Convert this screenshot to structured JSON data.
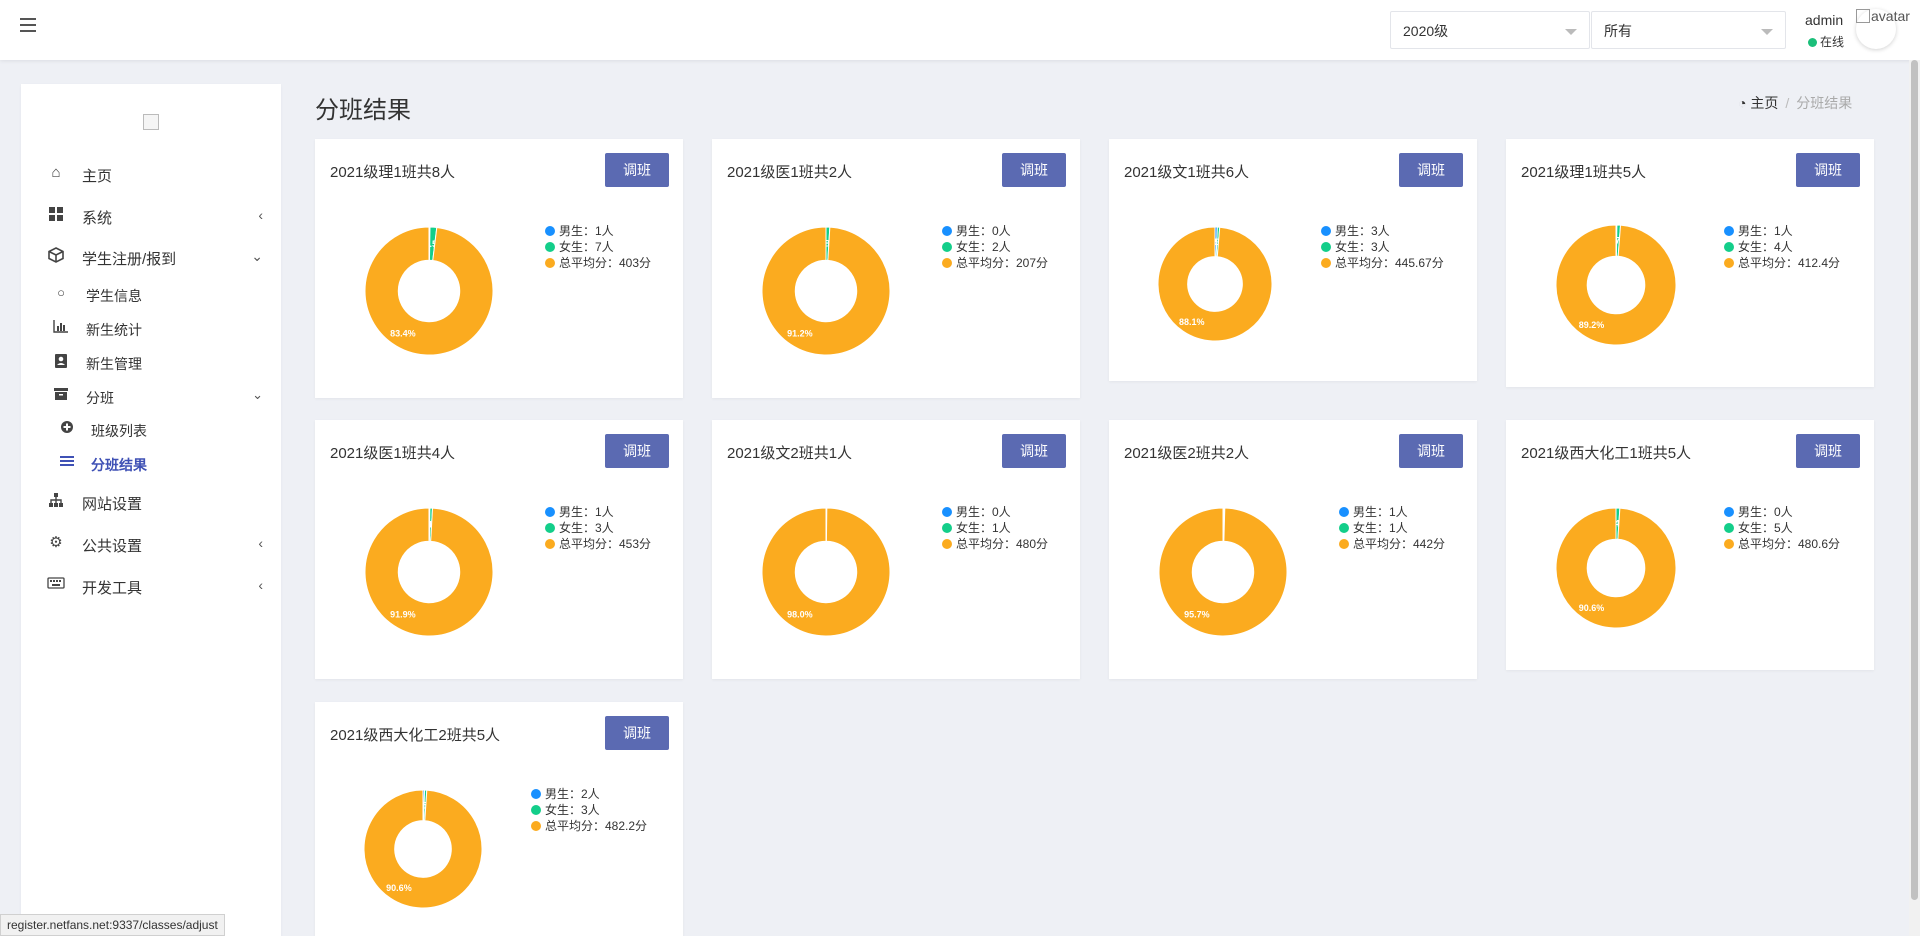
{
  "topbar": {
    "grade_select": "2020级",
    "scope_select": "所有",
    "user_name": "admin",
    "user_status": "在线",
    "avatar_alt": "avatar"
  },
  "sidebar": {
    "items": [
      {
        "label": "主页",
        "icon": "home-icon"
      },
      {
        "label": "系统",
        "icon": "windows-icon"
      },
      {
        "label": "学生注册/报到",
        "icon": "cube-icon"
      },
      {
        "label": "学生信息",
        "icon": "circle-icon"
      },
      {
        "label": "新生统计",
        "icon": "bar-chart-icon"
      },
      {
        "label": "新生管理",
        "icon": "contact-book-icon"
      },
      {
        "label": "分班",
        "icon": "archive-icon"
      },
      {
        "label": "班级列表",
        "icon": "plus-circle-icon"
      },
      {
        "label": "分班结果",
        "icon": "list-icon"
      },
      {
        "label": "网站设置",
        "icon": "sitemap-icon"
      },
      {
        "label": "公共设置",
        "icon": "gears-icon"
      },
      {
        "label": "开发工具",
        "icon": "keyboard-icon"
      }
    ]
  },
  "header": {
    "title": "分班结果",
    "breadcrumb_home": "主页",
    "breadcrumb_current": "分班结果"
  },
  "button_label": "调班",
  "colors": {
    "male": "#1890ff",
    "female": "#13ce8a",
    "avg": "#fbab1f",
    "accent": "#5b6ab2"
  },
  "chart_data": [
    {
      "type": "pie",
      "title": "2021级理1班共8人",
      "categories": [
        "男生",
        "女生",
        "总平均分"
      ],
      "values": [
        1,
        7,
        403
      ],
      "data_labels": [
        "",
        "14.5%",
        "83.4%"
      ],
      "legend": [
        "男生：1人",
        "女生：7人",
        "总平均分：403分"
      ]
    },
    {
      "type": "pie",
      "title": "2021级医1班共2人",
      "categories": [
        "男生",
        "女生",
        "总平均分"
      ],
      "values": [
        0,
        2,
        207
      ],
      "data_labels": [
        "",
        "8.8%",
        "91.2%"
      ],
      "legend": [
        "男生：0人",
        "女生：2人",
        "总平均分：207分"
      ]
    },
    {
      "type": "pie",
      "title": "2021级文1班共6人",
      "categories": [
        "男生",
        "女生",
        "总平均分"
      ],
      "values": [
        3,
        3,
        445.67
      ],
      "data_labels": [
        "5.9%",
        "5.9%",
        "88.1%"
      ],
      "legend": [
        "男生：3人",
        "女生：3人",
        "总平均分：445.67分"
      ]
    },
    {
      "type": "pie",
      "title": "2021级理1班共5人",
      "categories": [
        "男生",
        "女生",
        "总平均分"
      ],
      "values": [
        1,
        4,
        412.4
      ],
      "data_labels": [
        "",
        "8.7%",
        "89.2%"
      ],
      "legend": [
        "男生：1人",
        "女生：4人",
        "总平均分：412.4分"
      ]
    },
    {
      "type": "pie",
      "title": "2021级医1班共4人",
      "categories": [
        "男生",
        "女生",
        "总平均分"
      ],
      "values": [
        1,
        3,
        453
      ],
      "data_labels": [
        "",
        "6.1%",
        "91.9%"
      ],
      "legend": [
        "男生：1人",
        "女生：3人",
        "总平均分：453分"
      ]
    },
    {
      "type": "pie",
      "title": "2021级文2班共1人",
      "categories": [
        "男生",
        "女生",
        "总平均分"
      ],
      "values": [
        0,
        1,
        480
      ],
      "data_labels": [
        "",
        "",
        "98.0%"
      ],
      "legend": [
        "男生：0人",
        "女生：1人",
        "总平均分：480分"
      ]
    },
    {
      "type": "pie",
      "title": "2021级医2班共2人",
      "categories": [
        "男生",
        "女生",
        "总平均分"
      ],
      "values": [
        1,
        1,
        442
      ],
      "data_labels": [
        "",
        "",
        "95.7%"
      ],
      "legend": [
        "男生：1人",
        "女生：1人",
        "总平均分：442分"
      ]
    },
    {
      "type": "pie",
      "title": "2021级西大化工1班共5人",
      "categories": [
        "男生",
        "女生",
        "总平均分"
      ],
      "values": [
        0,
        5,
        480.6
      ],
      "data_labels": [
        "",
        "9.4%",
        "90.6%"
      ],
      "legend": [
        "男生：0人",
        "女生：5人",
        "总平均分：480.6分"
      ]
    },
    {
      "type": "pie",
      "title": "2021级西大化工2班共5人",
      "categories": [
        "男生",
        "女生",
        "总平均分"
      ],
      "values": [
        2,
        3,
        482.2
      ],
      "data_labels": [
        "3.5%",
        "5.5%",
        "90.6%"
      ],
      "legend": [
        "男生：2人",
        "女生：3人",
        "总平均分：482.2分"
      ]
    }
  ],
  "status_url": "register.netfans.net:9337/classes/adjust"
}
